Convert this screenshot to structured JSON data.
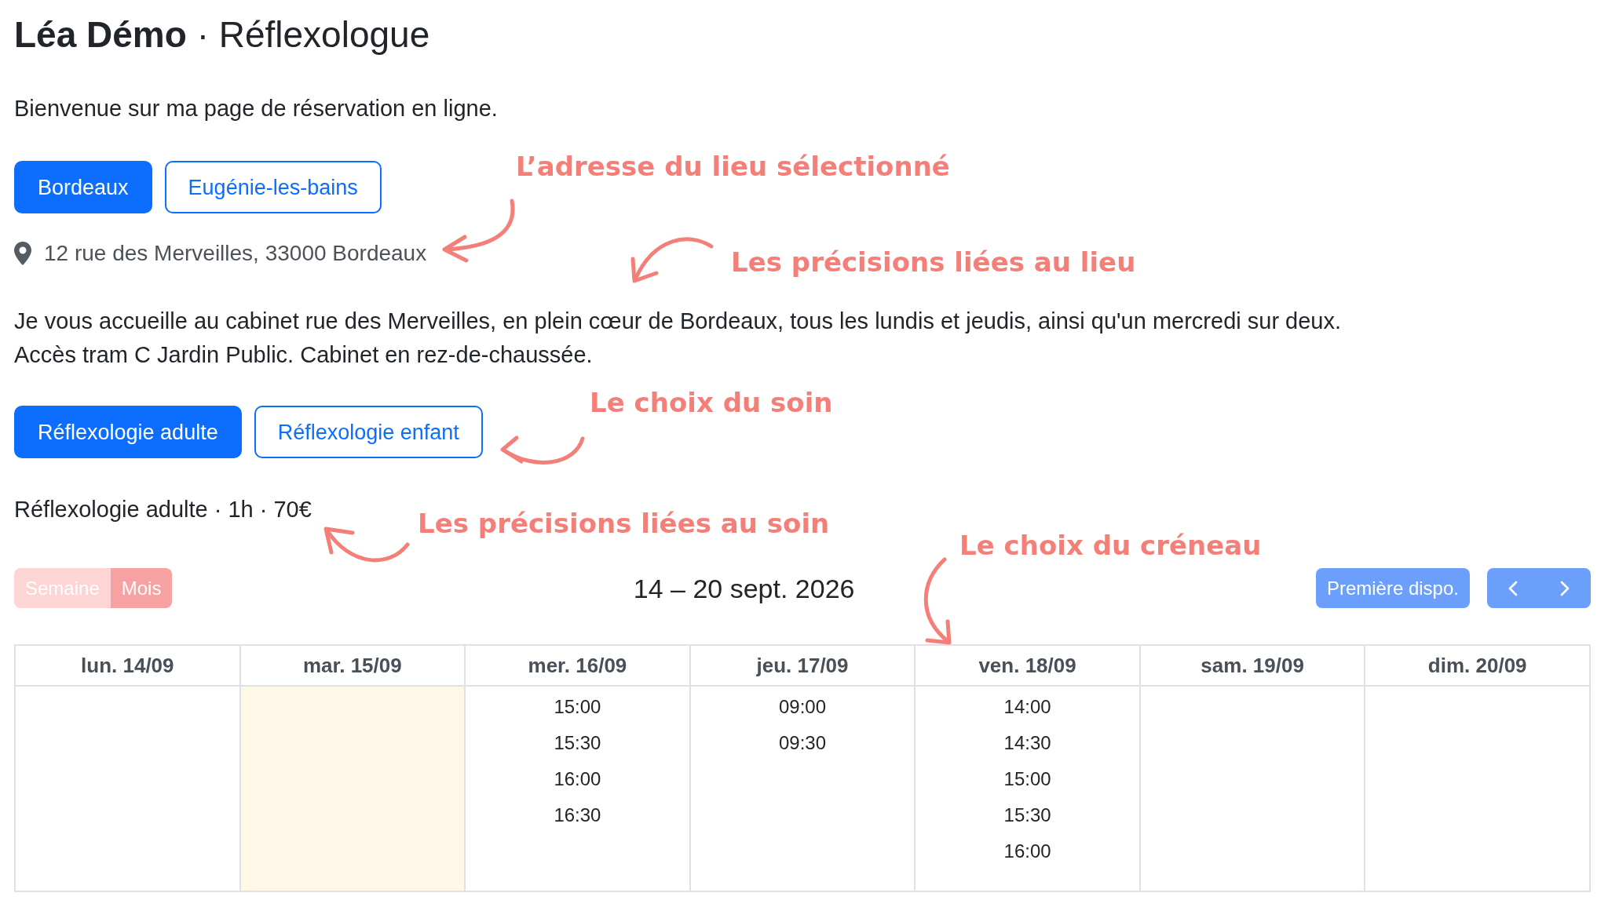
{
  "title": "**Léa Démo** · Réflexologue",
  "intro": "Bienvenue sur ma page de réservation en ligne.",
  "locations": [
    {
      "label": "Bordeaux",
      "selected": true
    },
    {
      "label": "Eugénie-les-bains",
      "selected": false
    }
  ],
  "address": "12 rue des Merveilles, 33000 Bordeaux",
  "location_details": [
    "Je vous accueille au cabinet rue des Merveilles, en plein cœur de Bordeaux, tous les lundis et jeudis, ainsi qu'un mercredi sur deux.",
    "Accès tram C Jardin Public. Cabinet en rez-de-chaussée."
  ],
  "services": [
    {
      "label": "Réflexologie adulte",
      "selected": true
    },
    {
      "label": "Réflexologie enfant",
      "selected": false
    }
  ],
  "service_summary": "Réflexologie adulte · 1h · 70€",
  "calendar": {
    "views": [
      {
        "label": "Semaine",
        "selected": true
      },
      {
        "label": "Mois",
        "selected": false
      }
    ],
    "range_title": "14 – 20 sept. 2026",
    "first_available_button": "Première dispo.",
    "days": [
      {
        "label": "lun. 14/09",
        "today": false
      },
      {
        "label": "mar. 15/09",
        "today": true
      },
      {
        "label": "mer. 16/09",
        "today": false,
        "slots": [
          "15:00",
          "15:30",
          "16:00",
          "16:30"
        ]
      },
      {
        "label": "jeu. 17/09",
        "today": false,
        "slots": [
          "09:00",
          "09:30"
        ]
      },
      {
        "label": "ven. 18/09",
        "today": false,
        "slots": [
          "14:00",
          "14:30",
          "15:00",
          "15:30",
          "16:00"
        ]
      },
      {
        "label": "sam. 19/09",
        "today": false
      },
      {
        "label": "dim. 20/09",
        "today": false
      }
    ]
  },
  "annotations": [
    "L’adresse du lieu sélectionné",
    "Les précisions liées au lieu",
    "Le choix du soin",
    "Les précisions liées au soin",
    "Le choix du créneau"
  ]
}
